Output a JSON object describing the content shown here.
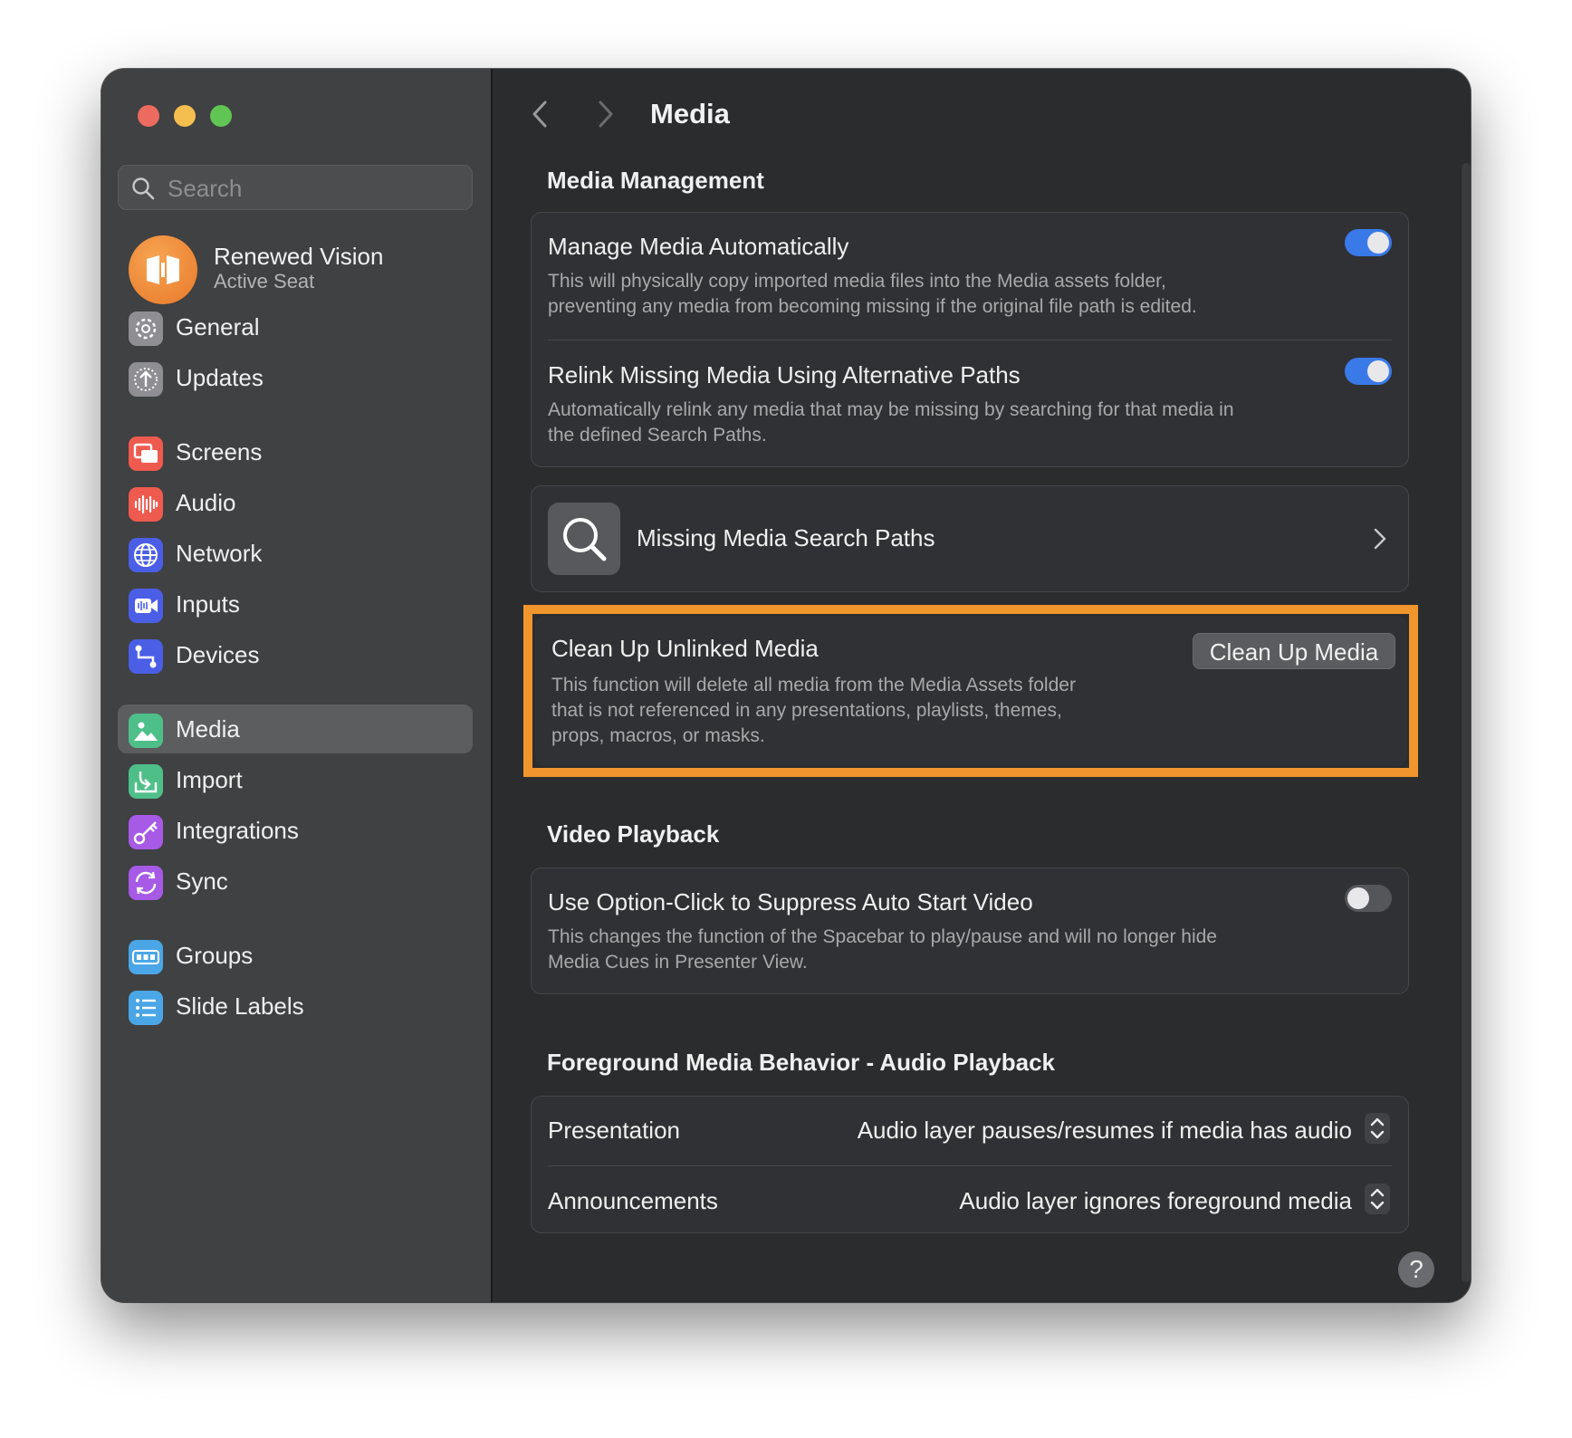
{
  "window": {
    "traffic_lights": [
      "close",
      "minimize",
      "zoom"
    ]
  },
  "sidebar": {
    "search_placeholder": "Search",
    "account": {
      "name": "Renewed Vision",
      "subtitle": "Active Seat"
    },
    "items": [
      {
        "label": "General",
        "icon": "gear-icon",
        "color": "#8e8e93"
      },
      {
        "label": "Updates",
        "icon": "upload-arrow-icon",
        "color": "#8e8e93"
      },
      {
        "label": "Screens",
        "icon": "screens-icon",
        "color": "#ef5a4f"
      },
      {
        "label": "Audio",
        "icon": "waveform-icon",
        "color": "#ef5a4f"
      },
      {
        "label": "Network",
        "icon": "globe-icon",
        "color": "#4b5ee6"
      },
      {
        "label": "Inputs",
        "icon": "video-input-icon",
        "color": "#4b5ee6"
      },
      {
        "label": "Devices",
        "icon": "devices-icon",
        "color": "#4b5ee6"
      },
      {
        "label": "Media",
        "icon": "photo-icon",
        "color": "#4fbf8a",
        "selected": true
      },
      {
        "label": "Import",
        "icon": "import-icon",
        "color": "#4fbf8a"
      },
      {
        "label": "Integrations",
        "icon": "key-icon",
        "color": "#a65ae6"
      },
      {
        "label": "Sync",
        "icon": "sync-icon",
        "color": "#a65ae6"
      },
      {
        "label": "Groups",
        "icon": "groups-icon",
        "color": "#4aa6e6"
      },
      {
        "label": "Slide Labels",
        "icon": "list-icon",
        "color": "#4aa6e6"
      }
    ]
  },
  "header": {
    "title": "Media"
  },
  "media_management": {
    "title": "Media Management",
    "manage_auto": {
      "title": "Manage Media Automatically",
      "desc1": "This will physically copy imported media files into the Media assets folder,",
      "desc2": "preventing any media from becoming missing if the original file path is edited.",
      "enabled": true
    },
    "relink": {
      "title": "Relink Missing Media Using Alternative Paths",
      "desc1": "Automatically relink any media that may be missing by searching for that media in",
      "desc2": "the defined Search Paths.",
      "enabled": true
    },
    "search_paths": {
      "title": "Missing Media Search Paths"
    },
    "clean_up": {
      "title": "Clean Up Unlinked Media",
      "desc1": "This function will delete all media from the Media Assets folder",
      "desc2": "that is not referenced in any presentations, playlists, themes,",
      "desc3": "props, macros, or masks.",
      "button": "Clean Up Media",
      "highlight_color": "#f0962d"
    }
  },
  "video_playback": {
    "title": "Video Playback",
    "option_click": {
      "title": "Use Option-Click to Suppress Auto Start Video",
      "desc1": "This changes the function of the Spacebar to play/pause and will no longer hide",
      "desc2": "Media Cues in Presenter View.",
      "enabled": false
    }
  },
  "foreground_audio": {
    "title": "Foreground Media Behavior - Audio Playback",
    "rows": [
      {
        "label": "Presentation",
        "value": "Audio layer pauses/resumes if media has audio"
      },
      {
        "label": "Announcements",
        "value": "Audio layer ignores foreground media"
      }
    ]
  },
  "help_label": "?"
}
